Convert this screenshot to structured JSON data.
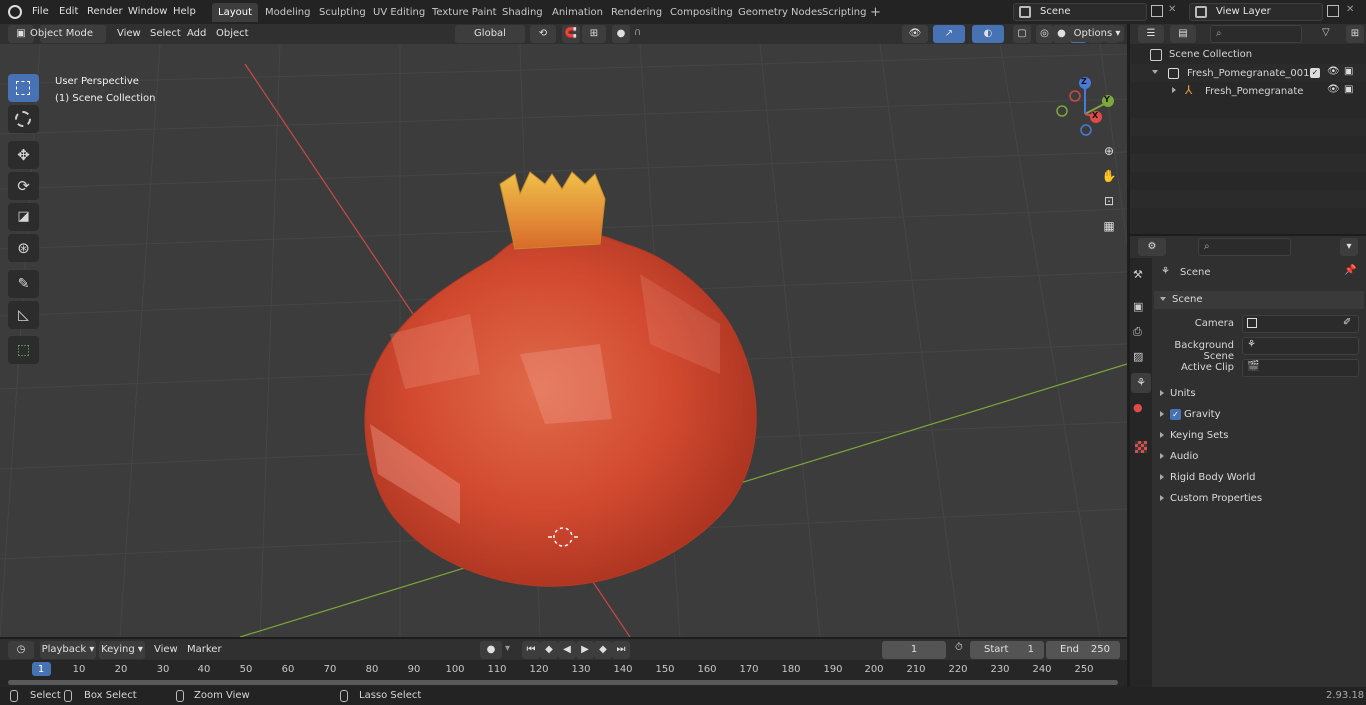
{
  "topbar": {
    "menus": [
      "File",
      "Edit",
      "Render",
      "Window",
      "Help"
    ],
    "workspaces": [
      "Layout",
      "Modeling",
      "Sculpting",
      "UV Editing",
      "Texture Paint",
      "Shading",
      "Animation",
      "Rendering",
      "Compositing",
      "Geometry Nodes",
      "Scripting"
    ],
    "active_workspace": "Layout",
    "scene_name": "Scene",
    "view_layer": "View Layer"
  },
  "viewport_header": {
    "mode": "Object Mode",
    "menus": [
      "View",
      "Select",
      "Add",
      "Object"
    ],
    "transform_orientation": "Global",
    "options_label": "Options"
  },
  "viewport": {
    "perspective_label": "User Perspective",
    "collection_label": "(1) Scene Collection",
    "gizmo_axes": [
      "X",
      "Y",
      "Z"
    ]
  },
  "outliner": {
    "root": "Scene Collection",
    "items": [
      {
        "label": "Fresh_Pomegranate_001"
      },
      {
        "label": "Fresh_Pomegranate"
      }
    ]
  },
  "properties": {
    "context_title": "Scene",
    "panel_title": "Scene",
    "fields": [
      {
        "label": "Camera"
      },
      {
        "label": "Background Scene"
      },
      {
        "label": "Active Clip"
      }
    ],
    "subpanels": [
      "Units",
      "Gravity",
      "Keying Sets",
      "Audio",
      "Rigid Body World",
      "Custom Properties"
    ],
    "gravity_checked": true
  },
  "timeline": {
    "menus": [
      "Playback",
      "Keying",
      "View",
      "Marker"
    ],
    "current_frame": "1",
    "start_label": "Start",
    "start_value": "1",
    "end_label": "End",
    "end_value": "250",
    "ruler": [
      "1",
      "10",
      "20",
      "30",
      "40",
      "50",
      "60",
      "70",
      "80",
      "90",
      "100",
      "110",
      "120",
      "130",
      "140",
      "150",
      "160",
      "170",
      "180",
      "190",
      "200",
      "210",
      "220",
      "230",
      "240",
      "250"
    ]
  },
  "statusbar": {
    "select": "Select",
    "box_select": "Box Select",
    "zoom_view": "Zoom View",
    "lasso_select": "Lasso Select",
    "version": "2.93.18"
  },
  "colors": {
    "accent": "#4772b3",
    "x_axis": "#c84a4a",
    "y_axis": "#7aa83a",
    "pomegranate": "#d8523a"
  }
}
